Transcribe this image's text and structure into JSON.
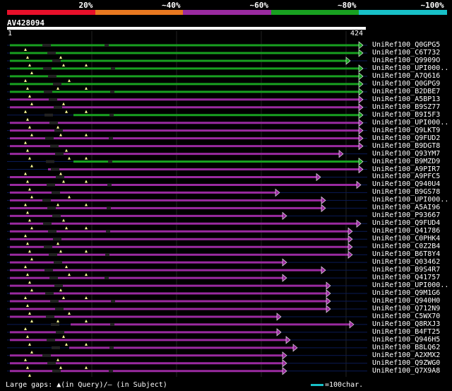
{
  "legend": {
    "labels": [
      "20%",
      "~40%",
      "~60%",
      "~80%",
      "~100%"
    ],
    "colors": [
      "#e8102a",
      "#e87820",
      "#9a2aa0",
      "#18a020",
      "#18c0c8"
    ]
  },
  "query": {
    "name": "AV428094",
    "start": "1",
    "end": "424"
  },
  "hits": [
    {
      "name": "UniRef100_Q0GPG5",
      "color": "#18a020",
      "start": 14,
      "end": 508
    },
    {
      "name": "UniRef100_C6T732",
      "color": "#18a020",
      "start": 14,
      "end": 508
    },
    {
      "name": "UniRef100_Q9909O",
      "color": "#18a020",
      "start": 14,
      "end": 490
    },
    {
      "name": "UniRef100_UPI000..",
      "color": "#18a020",
      "start": 14,
      "end": 508
    },
    {
      "name": "UniRef100_A7Q616",
      "color": "#18a020",
      "start": 14,
      "end": 508
    },
    {
      "name": "UniRef100_Q0GPG9",
      "color": "#18a020",
      "start": 14,
      "end": 508
    },
    {
      "name": "UniRef100_B2DBE7",
      "color": "#18a020",
      "start": 14,
      "end": 508
    },
    {
      "name": "UniRef100_A5BP13",
      "color": "#9a2aa0",
      "start": 14,
      "end": 508
    },
    {
      "name": "UniRef100_B9SZ77",
      "color": "#9a2aa0",
      "start": 14,
      "end": 508
    },
    {
      "name": "UniRef100_B9I5F3",
      "color": "#18a020",
      "start": 104,
      "end": 508
    },
    {
      "name": "UniRef100_UPI000..",
      "color": "#9a2aa0",
      "start": 14,
      "end": 508
    },
    {
      "name": "UniRef100_Q9LKT9",
      "color": "#9a2aa0",
      "start": 14,
      "end": 508
    },
    {
      "name": "UniRef100_Q9FUD2",
      "color": "#9a2aa0",
      "start": 14,
      "end": 508
    },
    {
      "name": "UniRef100_B9DGT8",
      "color": "#9a2aa0",
      "start": 14,
      "end": 508
    },
    {
      "name": "UniRef100_Q93YM7",
      "color": "#9a2aa0",
      "start": 14,
      "end": 480
    },
    {
      "name": "UniRef100_B9MZD9",
      "color": "#18a020",
      "start": 104,
      "end": 508
    },
    {
      "name": "UniRef100_A9PIR7",
      "color": "#9a2aa0",
      "start": 68,
      "end": 508
    },
    {
      "name": "UniRef100_A9PFC5",
      "color": "#9a2aa0",
      "start": 14,
      "end": 448
    },
    {
      "name": "UniRef100_Q940U4",
      "color": "#9a2aa0",
      "start": 14,
      "end": 505
    },
    {
      "name": "UniRef100_B9GS78",
      "color": "#9a2aa0",
      "start": 14,
      "end": 390
    },
    {
      "name": "UniRef100_UPI000..",
      "color": "#9a2aa0",
      "start": 14,
      "end": 455
    },
    {
      "name": "UniRef100_A5AI96",
      "color": "#9a2aa0",
      "start": 14,
      "end": 455
    },
    {
      "name": "UniRef100_P93667",
      "color": "#9a2aa0",
      "start": 14,
      "end": 400
    },
    {
      "name": "UniRef100_Q9FUD4",
      "color": "#9a2aa0",
      "start": 14,
      "end": 505
    },
    {
      "name": "UniRef100_Q41786",
      "color": "#9a2aa0",
      "start": 14,
      "end": 493
    },
    {
      "name": "UniRef100_C0PHK4",
      "color": "#9a2aa0",
      "start": 14,
      "end": 493
    },
    {
      "name": "UniRef100_C0Z2B4",
      "color": "#9a2aa0",
      "start": 14,
      "end": 493
    },
    {
      "name": "UniRef100_B6T8Y4",
      "color": "#9a2aa0",
      "start": 14,
      "end": 493
    },
    {
      "name": "UniRef100_Q03462",
      "color": "#9a2aa0",
      "start": 14,
      "end": 400
    },
    {
      "name": "UniRef100_B9S4R7",
      "color": "#9a2aa0",
      "start": 14,
      "end": 455
    },
    {
      "name": "UniRef100_Q41757",
      "color": "#9a2aa0",
      "start": 14,
      "end": 400
    },
    {
      "name": "UniRef100_UPI000..",
      "color": "#9a2aa0",
      "start": 14,
      "end": 462
    },
    {
      "name": "UniRef100_Q9M1G6",
      "color": "#9a2aa0",
      "start": 14,
      "end": 462
    },
    {
      "name": "UniRef100_Q940H0",
      "color": "#9a2aa0",
      "start": 14,
      "end": 462
    },
    {
      "name": "UniRef100_Q712N9",
      "color": "#9a2aa0",
      "start": 14,
      "end": 462
    },
    {
      "name": "UniRef100_C5WX70",
      "color": "#9a2aa0",
      "start": 14,
      "end": 392
    },
    {
      "name": "UniRef100_Q8RXJ3",
      "color": "#9a2aa0",
      "start": 100,
      "end": 495
    },
    {
      "name": "UniRef100_B4FT25",
      "color": "#9a2aa0",
      "start": 14,
      "end": 392
    },
    {
      "name": "UniRef100_Q946H5",
      "color": "#9a2aa0",
      "start": 14,
      "end": 405
    },
    {
      "name": "UniRef100_B8LQ62",
      "color": "#9a2aa0",
      "start": 98,
      "end": 415
    },
    {
      "name": "UniRef100_A2XMX2",
      "color": "#9a2aa0",
      "start": 14,
      "end": 400
    },
    {
      "name": "UniRef100_Q9ZWG0",
      "color": "#9a2aa0",
      "start": 14,
      "end": 400
    },
    {
      "name": "UniRef100_Q7X9A8",
      "color": "#9a2aa0",
      "start": 14,
      "end": 400
    }
  ],
  "footer": {
    "text": "Large gaps: ▲(in Query)/– (in Subject)",
    "scale_label": "=100char."
  }
}
